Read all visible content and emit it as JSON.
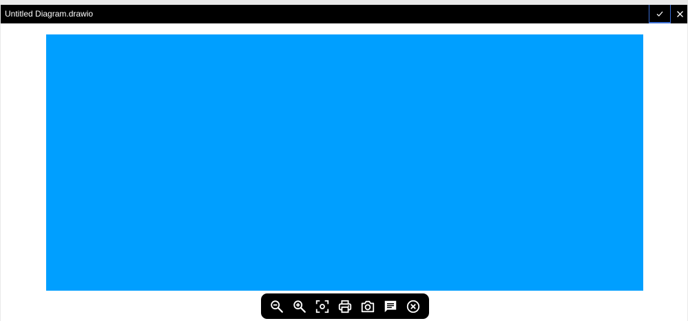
{
  "window": {
    "title": "Untitled Diagram.drawio",
    "confirm_icon": "checkmark-icon",
    "close_icon": "close-icon"
  },
  "canvas": {
    "fill_color": "#009fff"
  },
  "toolbar": {
    "items": [
      {
        "icon": "zoom-out-icon"
      },
      {
        "icon": "zoom-in-icon"
      },
      {
        "icon": "fit-to-screen-icon"
      },
      {
        "icon": "print-icon"
      },
      {
        "icon": "camera-icon"
      },
      {
        "icon": "comment-icon"
      },
      {
        "icon": "close-circle-icon"
      }
    ]
  }
}
